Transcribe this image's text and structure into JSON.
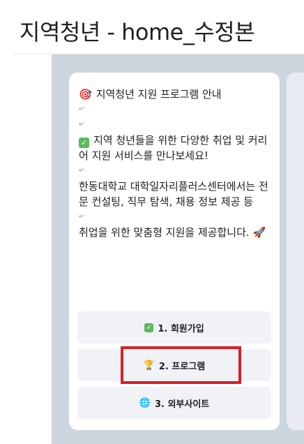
{
  "page": {
    "title": "지역청년 - home_수정본"
  },
  "message": {
    "title_emoji": "🎯",
    "title": "지역청년 지원 프로그램 안내",
    "break_mark": "↵",
    "intro_emoji": "✓",
    "intro": "지역 청년들을 위한 다양한 취업 및 커리어 지원 서비스를 만나보세요!",
    "body": "한동대학교 대학일자리플러스센터에서는 전문 컨설팅, 직무 탐색, 채용 정보 제공 등",
    "closing": "취업을 위한 맞춤형 지원을 제공합니다.",
    "closing_emoji": "🚀"
  },
  "buttons": [
    {
      "icon": "✓",
      "label": "1. 회원가입"
    },
    {
      "icon": "🏆",
      "label": "2. 프로그램"
    },
    {
      "icon": "🌐",
      "label": "3. 외부사이트"
    }
  ],
  "colors": {
    "highlight": "#d81f26",
    "canvas": "#cdd5de",
    "button_bg": "#f0f2f5"
  }
}
